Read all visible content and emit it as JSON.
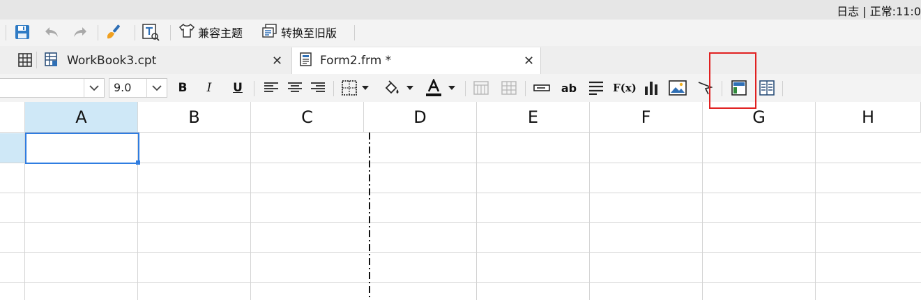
{
  "status_bar": {
    "text": "日志 | 正常:11:0"
  },
  "main_toolbar": {
    "theme_label": "兼容主题",
    "convert_label": "转换至旧版"
  },
  "tabs": [
    {
      "label": "WorkBook3.cpt",
      "icon": "workbook-icon"
    },
    {
      "label": "Form2.frm *",
      "icon": "form-icon"
    }
  ],
  "format_toolbar": {
    "font_name": "",
    "font_size": "9.0",
    "bold": "B",
    "italic": "I",
    "underline": "U",
    "text_widget": "ab",
    "formula": "F(x)"
  },
  "grid": {
    "columns": [
      "A",
      "B",
      "C",
      "D",
      "E",
      "F",
      "G",
      "H"
    ],
    "selected_cell": "A1"
  },
  "colors": {
    "accent": "#2f7de1",
    "selected_header": "#cfe8f7",
    "highlight_box": "#e02020"
  }
}
